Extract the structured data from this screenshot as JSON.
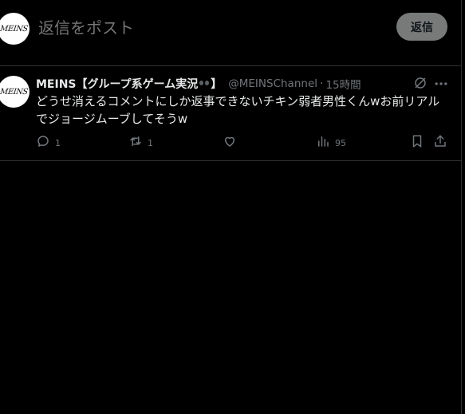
{
  "composer": {
    "placeholder": "返信をポスト",
    "reply_button": "返信",
    "avatar_logo": "MEINS"
  },
  "tweet": {
    "avatar_logo": "MEINS",
    "display_name": "MEINS【グループ系ゲーム実況",
    "display_name_end": "】",
    "handle": "@MEINSChannel",
    "separator": "·",
    "time": "15時間",
    "text": "どうせ消えるコメントにしか返事できないチキン弱者男性くんwお前リアル\nでジョージムーブしてそうw",
    "actions": {
      "reply_count": "1",
      "repost_count": "1",
      "like_count": "",
      "views_count": "95"
    }
  },
  "colors": {
    "background": "#000000",
    "text_primary": "#e7e9ea",
    "text_secondary": "#71767b",
    "border": "#2f3336",
    "reply_button_bg": "#787a7a"
  },
  "icons": [
    "reply-icon",
    "repost-icon",
    "like-icon",
    "views-icon",
    "bookmark-icon",
    "share-icon",
    "grok-icon",
    "more-icon"
  ]
}
